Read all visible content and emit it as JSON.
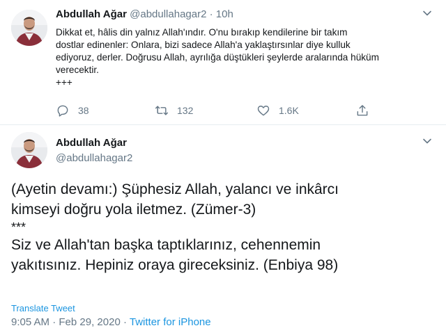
{
  "tweet1": {
    "author_name": "Abdullah Ağar",
    "author_handle": "@abdullahagar2",
    "separator": "·",
    "time": "10h",
    "text_lines": [
      "Dikkat et, hâlis din yalnız Allah'ındır. O'nu bırakıp kendilerine bir takım",
      "dostlar edinenler: Onlara, bizi sadece Allah'a yaklaştırsınlar diye kulluk",
      "ediyoruz, derler. Doğrusu Allah, ayrılığa düştükleri şeylerde aralarında hüküm",
      "verecektir.",
      "+++"
    ],
    "replies": "38",
    "retweets": "132",
    "likes": "1.6K"
  },
  "tweet2": {
    "author_name": "Abdullah Ağar",
    "author_handle": "@abdullahagar2",
    "body_lines": [
      "(Ayetin devamı:) Şüphesiz Allah, yalancı ve inkârcı",
      "kimseyi doğru yola iletmez.  (Zümer-3)",
      "***",
      "Siz ve Allah'tan başka taptıklarınız, cehennemin",
      "yakıtısınız. Hepiniz oraya gireceksiniz. (Enbiya 98)"
    ],
    "translate_label": "Translate Tweet",
    "time": "9:05 AM",
    "date": "Feb 29, 2020",
    "source": "Twitter for iPhone"
  },
  "icons": {
    "reply": "reply-icon",
    "retweet": "retweet-icon",
    "like": "like-icon",
    "share": "share-icon",
    "more": "chevron-down-icon"
  },
  "colors": {
    "link": "#1b95e0",
    "secondary": "#657786",
    "text": "#14171a",
    "divider": "#e6ecf0"
  }
}
